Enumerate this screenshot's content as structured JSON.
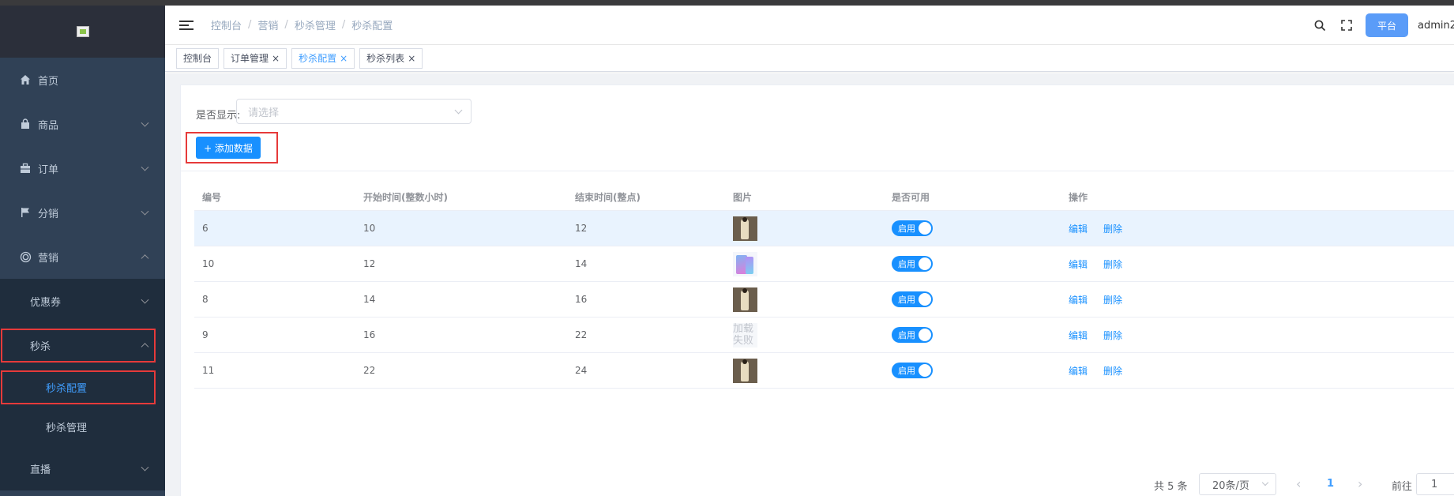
{
  "sidebar": {
    "items": [
      {
        "label": "首页",
        "icon": "home-icon"
      },
      {
        "label": "商品",
        "icon": "bag-icon"
      },
      {
        "label": "订单",
        "icon": "briefcase-icon"
      },
      {
        "label": "分销",
        "icon": "flag-icon"
      },
      {
        "label": "营销",
        "icon": "target-icon"
      }
    ],
    "marketing_sub": [
      {
        "label": "优惠券"
      },
      {
        "label": "秒杀"
      }
    ],
    "seckill_sub": [
      {
        "label": "秒杀配置"
      },
      {
        "label": "秒杀管理"
      }
    ],
    "live": {
      "label": "直播"
    }
  },
  "navbar": {
    "breadcrumb": [
      "控制台",
      "营销",
      "秒杀管理",
      "秒杀配置"
    ],
    "platform_label": "平台",
    "user": "admin2"
  },
  "tags": [
    {
      "label": "控制台"
    },
    {
      "label": "订单管理"
    },
    {
      "label": "秒杀配置"
    },
    {
      "label": "秒杀列表"
    }
  ],
  "filter": {
    "label": "是否显示:",
    "placeholder": "请选择"
  },
  "add_button": "+ 添加数据",
  "table": {
    "headers": [
      "编号",
      "开始时间(整数小时)",
      "结束时间(整点)",
      "图片",
      "是否可用",
      "操作"
    ],
    "rows": [
      {
        "id": "6",
        "start": "10",
        "end": "12",
        "image": "model-coat",
        "status": "启用"
      },
      {
        "id": "10",
        "start": "12",
        "end": "14",
        "image": "phone",
        "status": "启用"
      },
      {
        "id": "8",
        "start": "14",
        "end": "16",
        "image": "model-coat",
        "status": "启用"
      },
      {
        "id": "9",
        "start": "16",
        "end": "22",
        "image": "loading",
        "image_text": "加载失败",
        "status": "启用"
      },
      {
        "id": "11",
        "start": "22",
        "end": "24",
        "image": "model-coat",
        "status": "启用"
      }
    ],
    "edit_label": "编辑",
    "delete_label": "删除"
  },
  "pagination": {
    "total": "共 5 条",
    "page_size": "20条/页",
    "current": "1",
    "goto_label": "前往",
    "goto_value": "1"
  },
  "colors": {
    "sidebar_bg": "#304156",
    "submenu_bg": "#1f2d3d",
    "primary": "#1890ff",
    "highlight_border": "#e63a3a"
  }
}
